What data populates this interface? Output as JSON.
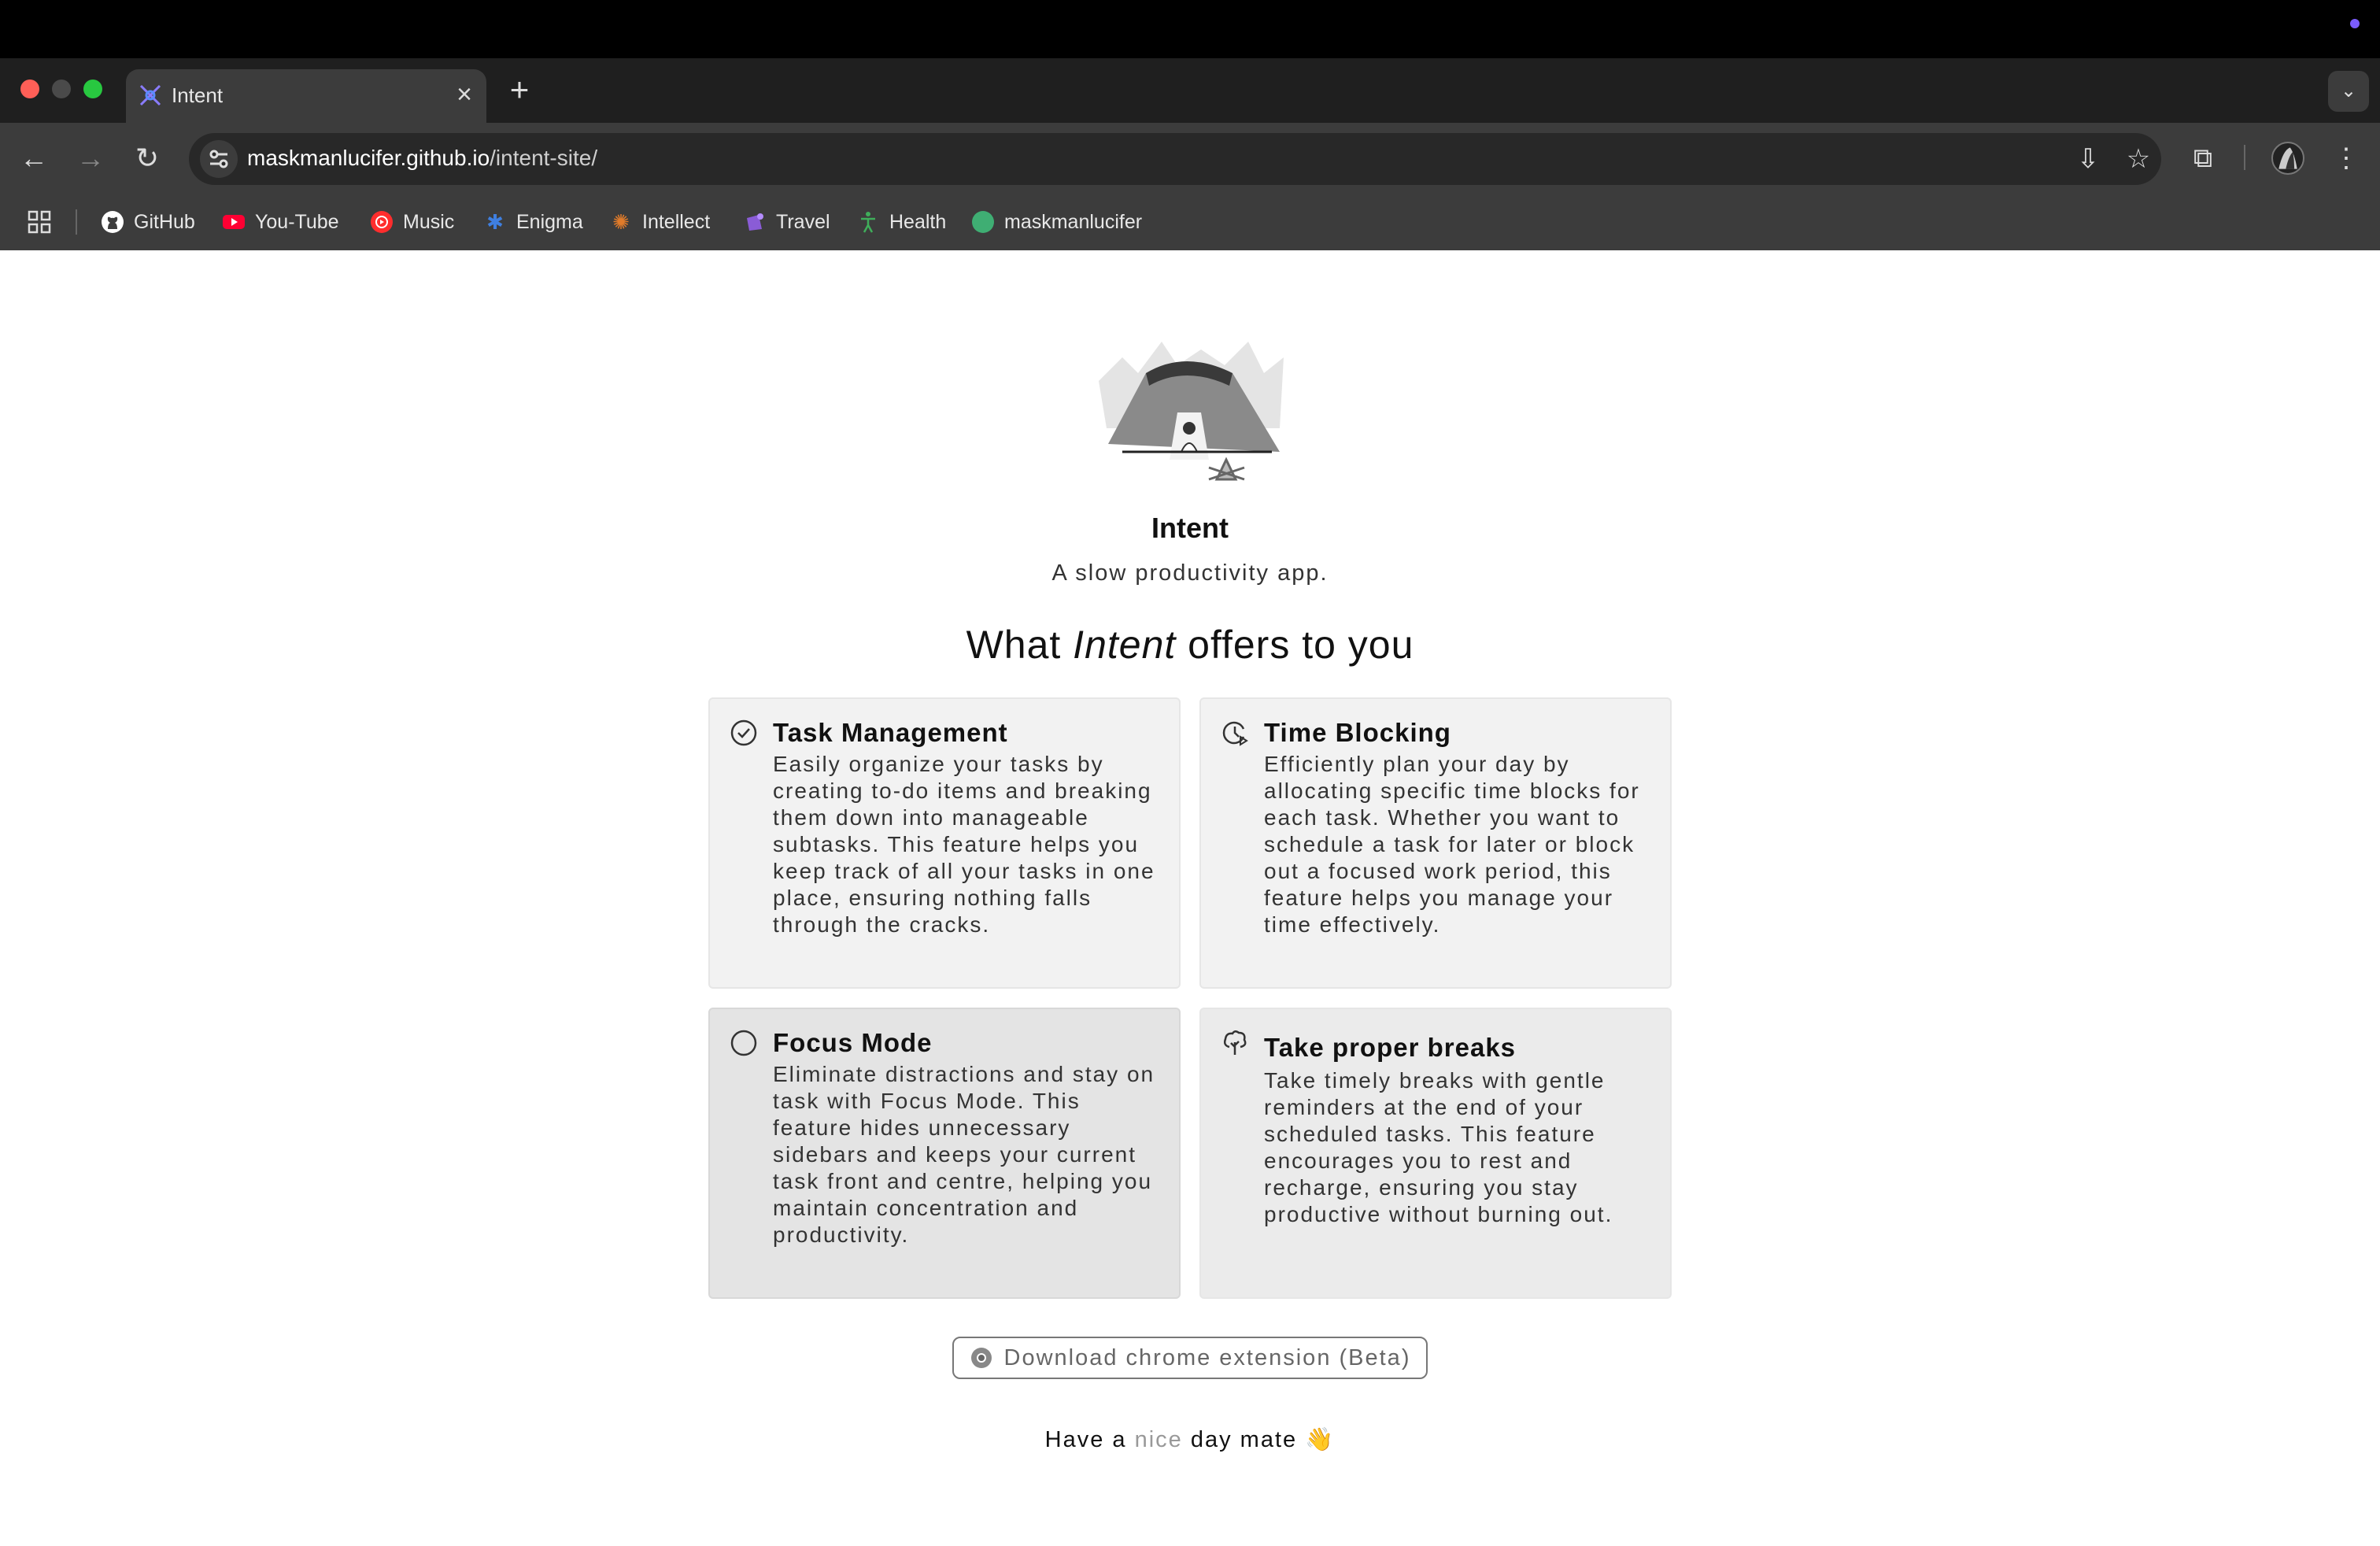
{
  "browser": {
    "tab_title": "Intent",
    "new_tab_symbol": "+",
    "close_symbol": "×",
    "url_host": "maskmanlucifer.github.io",
    "url_path": "/intent-site/"
  },
  "bookmarks": [
    {
      "label": "GitHub",
      "icon": "github-icon",
      "color": "#ffffff"
    },
    {
      "label": "You-Tube",
      "icon": "youtube-icon",
      "color": "#ff0033"
    },
    {
      "label": "Music",
      "icon": "music-icon",
      "color": "#ff2d2d"
    },
    {
      "label": "Enigma",
      "icon": "enigma-icon",
      "color": "#3f7fe0"
    },
    {
      "label": "Intellect",
      "icon": "intellect-icon",
      "color": "#e07b2a"
    },
    {
      "label": "Travel",
      "icon": "travel-icon",
      "color": "#8a5cd6"
    },
    {
      "label": "Health",
      "icon": "health-icon",
      "color": "#3fae5a"
    },
    {
      "label": "maskmanlucifer",
      "icon": "profile-dot-icon",
      "color": "#3fae73"
    }
  ],
  "page": {
    "title": "Intent",
    "tagline": "A slow productivity app.",
    "offers_prefix": "What ",
    "offers_em": "Intent",
    "offers_suffix": " offers to you",
    "features": [
      {
        "title": "Task Management",
        "icon": "check-circle-icon",
        "text": "Easily organize your tasks by creating to-do items and breaking them down into manageable subtasks. This feature helps you keep track of all your tasks in one place, ensuring nothing falls through the cracks."
      },
      {
        "title": "Time Blocking",
        "icon": "clock-icon",
        "text": "Efficiently plan your day by allocating specific time blocks for each task. Whether you want to schedule a task for later or block out a focused work period, this feature helps you manage your time effectively."
      },
      {
        "title": "Focus Mode",
        "icon": "circle-icon",
        "text": "Eliminate distractions and stay on task with Focus Mode. This feature hides unnecessary sidebars and keeps your current task front and centre, helping you maintain concentration and productivity."
      },
      {
        "title": "Take proper breaks",
        "icon": "tree-icon",
        "text": "Take timely breaks with gentle reminders at the end of your scheduled tasks. This feature encourages you to rest and recharge, ensuring you stay productive without burning out."
      }
    ],
    "download_label": "Download chrome extension (Beta)",
    "footer_prefix": "Have a ",
    "footer_nice": "nice",
    "footer_suffix": " day mate ",
    "footer_emoji": "👋"
  }
}
